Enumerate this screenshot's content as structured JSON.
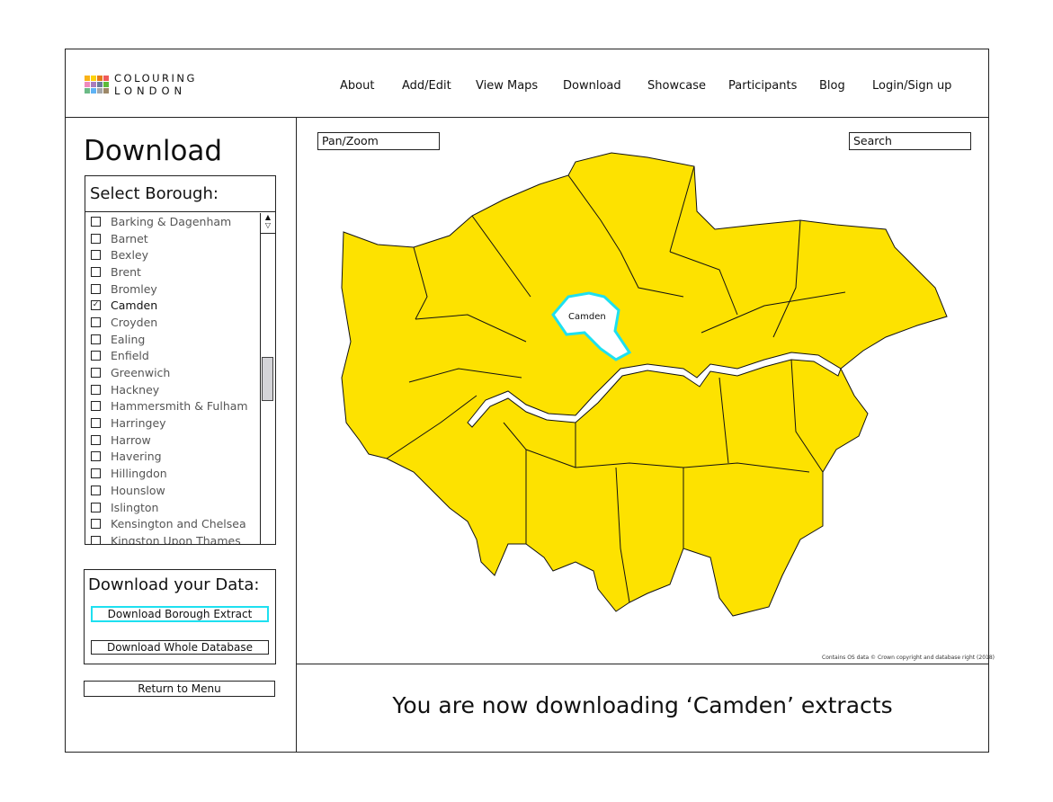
{
  "logo": {
    "line1": "COLOURING",
    "line2": "LONDON",
    "colors": [
      "#f9b317",
      "#fdd20b",
      "#e57b19",
      "#ef5a5a",
      "#ef8bbd",
      "#a97ebd",
      "#6b7c9b",
      "#5cbb3a",
      "#6bba86",
      "#5fb3f5",
      "#a5a6a8",
      "#9d8868"
    ]
  },
  "nav": [
    "About",
    "Add/Edit",
    "View Maps",
    "Download",
    "Showcase",
    "Participants",
    "Blog",
    "Login/Sign up"
  ],
  "sidebar": {
    "title": "Download",
    "select_heading": "Select Borough:",
    "boroughs": [
      {
        "label": "Barking & Dagenham",
        "checked": false
      },
      {
        "label": "Barnet",
        "checked": false
      },
      {
        "label": "Bexley",
        "checked": false
      },
      {
        "label": "Brent",
        "checked": false
      },
      {
        "label": "Bromley",
        "checked": false
      },
      {
        "label": "Camden",
        "checked": true
      },
      {
        "label": "Croyden",
        "checked": false
      },
      {
        "label": "Ealing",
        "checked": false
      },
      {
        "label": "Enfield",
        "checked": false
      },
      {
        "label": "Greenwich",
        "checked": false
      },
      {
        "label": "Hackney",
        "checked": false
      },
      {
        "label": "Hammersmith & Fulham",
        "checked": false
      },
      {
        "label": "Harringey",
        "checked": false
      },
      {
        "label": "Harrow",
        "checked": false
      },
      {
        "label": "Havering",
        "checked": false
      },
      {
        "label": "Hillingdon",
        "checked": false
      },
      {
        "label": "Hounslow",
        "checked": false
      },
      {
        "label": "Islington",
        "checked": false
      },
      {
        "label": "Kensington and Chelsea",
        "checked": false
      },
      {
        "label": "Kingston Upon Thames",
        "checked": false
      }
    ],
    "download_heading": "Download your Data:",
    "download_extract": "Download Borough Extract",
    "download_whole": "Download Whole Database",
    "return": "Return to Menu"
  },
  "map": {
    "pan_zoom": "Pan/Zoom",
    "search": "Search",
    "selected_label": "Camden",
    "credit": "Contains OS data © Crown copyright and database right (2018)",
    "fill_color": "#fde200",
    "highlight_color": "#1ee0f0"
  },
  "status": "You are now downloading ‘Camden’ extracts"
}
